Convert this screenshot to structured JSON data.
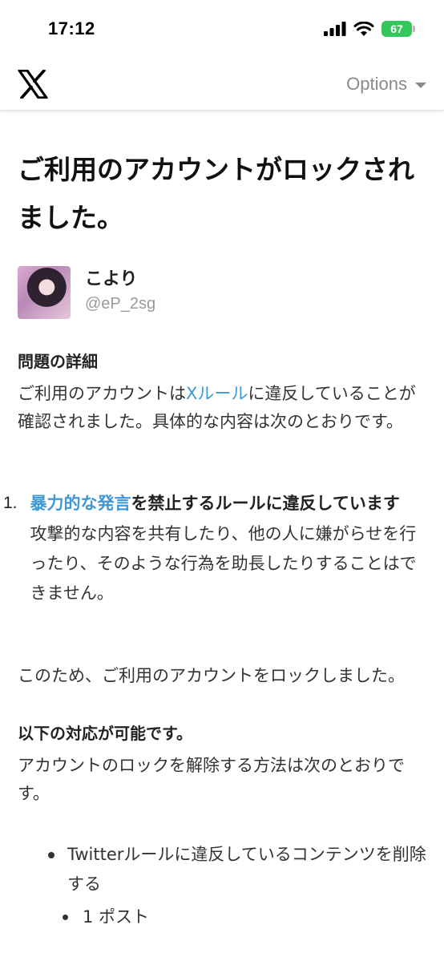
{
  "status_bar": {
    "time": "17:12",
    "battery": "67"
  },
  "header": {
    "logo": "X",
    "options_label": "Options"
  },
  "page_title": "ご利用のアカウントがロックされました。",
  "user": {
    "name": "こより",
    "handle": "@eP_2sg"
  },
  "problem": {
    "heading": "問題の詳細",
    "text_before": "ご利用のアカウントは",
    "link": "Xルール",
    "text_after": "に違反していることが確認されました。具体的な内容は次のとおりです。"
  },
  "violation": {
    "number": "1.",
    "link": "暴力的な発言",
    "title_rest": "を禁止するルールに違反しています",
    "description": "攻撃的な内容を共有したり、他の人に嫌がらせを行ったり、そのような行為を助長したりすることはできません。"
  },
  "locked_text": "このため、ご利用のアカウントをロックしました。",
  "actions": {
    "heading": "以下の対応が可能です。",
    "text": "アカウントのロックを解除する方法は次のとおりです。",
    "bullet": "Twitterルールに違反しているコンテンツを削除する",
    "sub_bullet": "1 ポスト"
  }
}
